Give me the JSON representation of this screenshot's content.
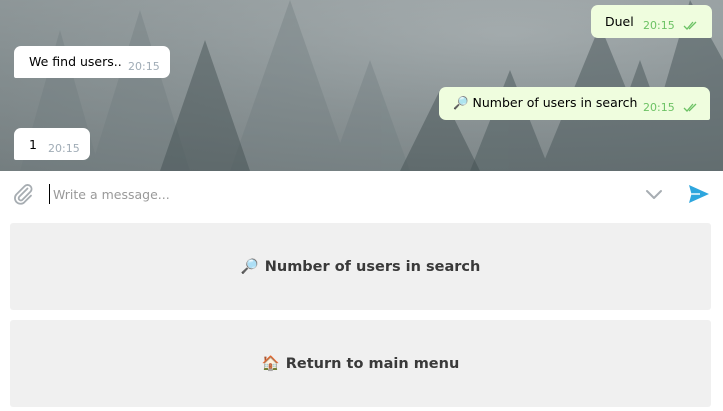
{
  "messages": [
    {
      "direction": "out",
      "text": "Duel",
      "time": "20:15",
      "status": "read"
    },
    {
      "direction": "in",
      "text": "We find users..",
      "time": "20:15"
    },
    {
      "direction": "out",
      "text": "🔎 Number of users in search",
      "time": "20:15",
      "status": "read"
    },
    {
      "direction": "in",
      "text": "1",
      "time": "20:15"
    }
  ],
  "composer": {
    "placeholder": "Write a message...",
    "value": "",
    "icons": [
      "paperclip-icon",
      "chevron-down-icon",
      "send-icon"
    ],
    "send_color": "#2ea6de"
  },
  "keyboard": {
    "buttons": [
      {
        "emoji": "🔎",
        "label": "Number of users in search"
      },
      {
        "emoji": "🏠",
        "label": "Return to main menu"
      }
    ]
  },
  "colors": {
    "outgoing_bubble": "#effdde",
    "incoming_bubble": "#ffffff",
    "outgoing_time": "#6cc264",
    "keyboard_button": "#f0f0f0"
  }
}
